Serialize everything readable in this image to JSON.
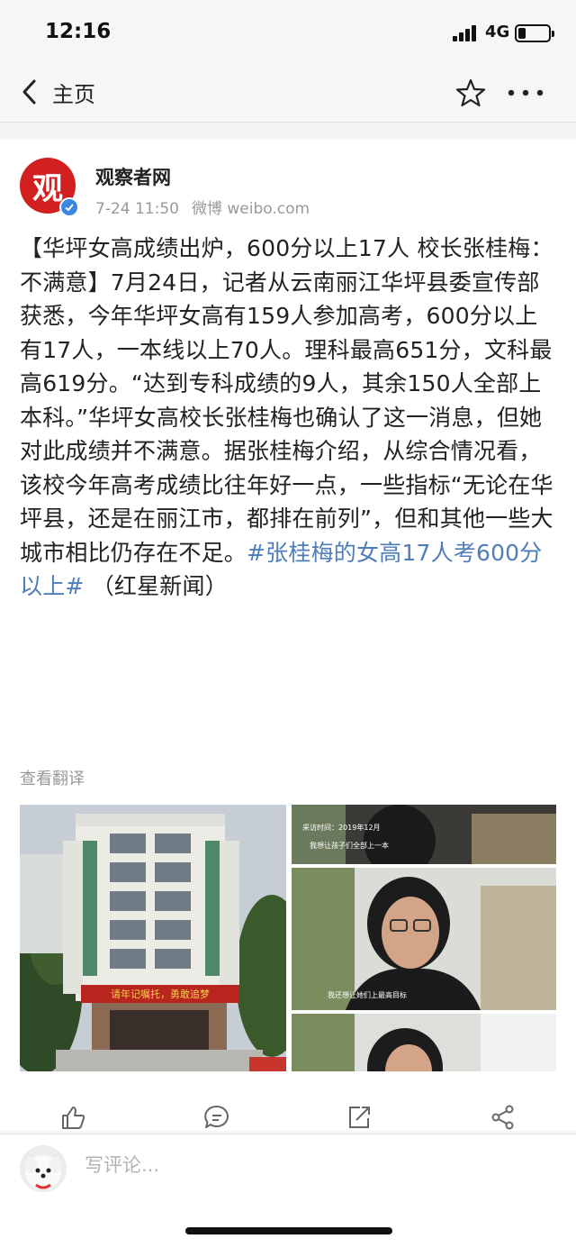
{
  "status_bar": {
    "time": "12:16",
    "network": "4G",
    "battery_level": 0.25
  },
  "nav": {
    "back_label": "主页",
    "icons": [
      "chevron-left-icon",
      "star-icon",
      "more-icon"
    ]
  },
  "post": {
    "username": "观察者网",
    "avatar_text": "观",
    "verified": true,
    "date": "7-24 11:50",
    "source": "微博 weibo.com",
    "body": "【华坪女高成绩出炉，600分以上17人 校长张桂梅：不满意】7月24日，记者从云南丽江华坪县委宣传部获悉，今年华坪女高有159人参加高考，600分以上有17人，一本线以上70人。理科最高651分，文科最高619分。“达到专科成绩的9人，其余150人全部上本科。”华坪女高校长张桂梅也确认了这一消息，但她对此成绩并不满意。据张桂梅介绍，从综合情况看，该校今年高考成绩比往年好一点，一些指标“无论在华坪县，还是在丽江市，都排在前列”，但和其他一些大城市相比仍存在不足。",
    "hashtag": "#张桂梅的女高17人考600分以上#",
    "source_note": " （红星新闻）",
    "translate_label": "查看翻译",
    "images": {
      "building_banner": "请年记嘱托，勇敢追梦",
      "video_captions": {
        "top_time": "采访时间：2019年12月",
        "top_quote": "我想让孩子们全部上一本",
        "mid_quote": "我还想让她们上最高目标"
      }
    }
  },
  "actions": {
    "icons": [
      "like-icon",
      "comment-icon",
      "repost-icon",
      "share-icon"
    ]
  },
  "comment_bar": {
    "placeholder": "写评论..."
  },
  "colors": {
    "hashtag": "#4f7db9",
    "avatar_red": "#d21f1f",
    "verified_blue": "#3b87e0",
    "meta_gray": "#999999"
  }
}
